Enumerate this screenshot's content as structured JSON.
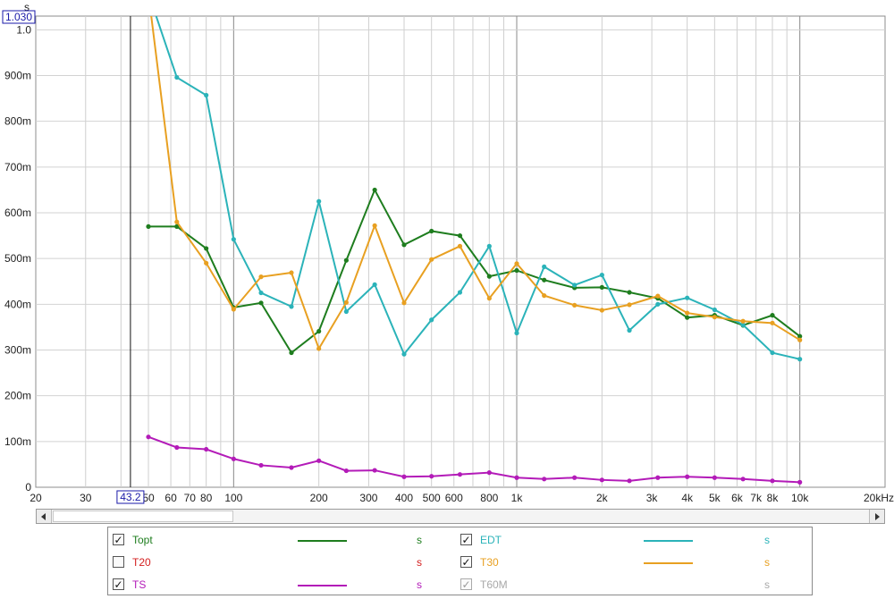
{
  "chart_data": {
    "type": "line",
    "x_scale": "log",
    "xlim": [
      20,
      20000
    ],
    "ylim": [
      0,
      1.03
    ],
    "grid": true,
    "y_unit_label": "s",
    "y_top_marker": "1.030",
    "x_cursor_label": "43.2",
    "x_cursor_value": 43.2,
    "y_ticks": [
      {
        "v": 0,
        "label": "0"
      },
      {
        "v": 0.1,
        "label": "100m"
      },
      {
        "v": 0.2,
        "label": "200m"
      },
      {
        "v": 0.3,
        "label": "300m"
      },
      {
        "v": 0.4,
        "label": "400m"
      },
      {
        "v": 0.5,
        "label": "500m"
      },
      {
        "v": 0.6,
        "label": "600m"
      },
      {
        "v": 0.7,
        "label": "700m"
      },
      {
        "v": 0.8,
        "label": "800m"
      },
      {
        "v": 0.9,
        "label": "900m"
      },
      {
        "v": 1.0,
        "label": "1.0"
      }
    ],
    "x_ticks": [
      {
        "v": 20,
        "label": "20"
      },
      {
        "v": 30,
        "label": "30"
      },
      {
        "v": 50,
        "label": "50"
      },
      {
        "v": 60,
        "label": "60"
      },
      {
        "v": 70,
        "label": "70"
      },
      {
        "v": 80,
        "label": "80"
      },
      {
        "v": 100,
        "label": "100"
      },
      {
        "v": 200,
        "label": "200"
      },
      {
        "v": 300,
        "label": "300"
      },
      {
        "v": 400,
        "label": "400"
      },
      {
        "v": 500,
        "label": "500"
      },
      {
        "v": 600,
        "label": "600"
      },
      {
        "v": 800,
        "label": "800"
      },
      {
        "v": 1000,
        "label": "1k"
      },
      {
        "v": 2000,
        "label": "2k"
      },
      {
        "v": 3000,
        "label": "3k"
      },
      {
        "v": 4000,
        "label": "4k"
      },
      {
        "v": 5000,
        "label": "5k"
      },
      {
        "v": 6000,
        "label": "6k"
      },
      {
        "v": 7000,
        "label": "7k"
      },
      {
        "v": 8000,
        "label": "8k"
      },
      {
        "v": 10000,
        "label": "10k"
      },
      {
        "v": 20000,
        "label": "20kHz"
      }
    ],
    "x": [
      50,
      63,
      80,
      100,
      125,
      160,
      200,
      250,
      315,
      400,
      500,
      630,
      800,
      1000,
      1250,
      1600,
      2000,
      2500,
      3150,
      4000,
      5000,
      6300,
      8000,
      10000
    ],
    "series": [
      {
        "name": "Topt",
        "color": "#1e7d1e",
        "values": [
          0.57,
          0.57,
          0.522,
          0.393,
          0.403,
          0.294,
          0.341,
          0.496,
          0.65,
          0.53,
          0.56,
          0.55,
          0.461,
          0.474,
          0.453,
          0.436,
          0.437,
          0.426,
          0.413,
          0.371,
          0.376,
          0.354,
          0.376,
          0.33
        ]
      },
      {
        "name": "EDT",
        "color": "#2bb3b9",
        "values": [
          1.08,
          0.896,
          0.857,
          0.542,
          0.425,
          0.395,
          0.625,
          0.384,
          0.443,
          0.291,
          0.366,
          0.426,
          0.527,
          0.337,
          0.482,
          0.442,
          0.464,
          0.343,
          0.4,
          0.414,
          0.388,
          0.355,
          0.294,
          0.28
        ]
      },
      {
        "name": "T30",
        "color": "#e8a021",
        "values": [
          1.08,
          0.58,
          0.49,
          0.389,
          0.46,
          0.469,
          0.303,
          0.404,
          0.572,
          0.403,
          0.498,
          0.527,
          0.413,
          0.489,
          0.419,
          0.398,
          0.387,
          0.399,
          0.418,
          0.381,
          0.372,
          0.363,
          0.359,
          0.322
        ]
      },
      {
        "name": "TS",
        "color": "#b31bb8",
        "values": [
          0.11,
          0.087,
          0.083,
          0.062,
          0.048,
          0.043,
          0.058,
          0.036,
          0.037,
          0.023,
          0.024,
          0.028,
          0.032,
          0.021,
          0.018,
          0.021,
          0.016,
          0.014,
          0.021,
          0.023,
          0.021,
          0.018,
          0.014,
          0.011
        ]
      }
    ]
  },
  "legend": {
    "items": [
      {
        "name": "Topt",
        "checked": true,
        "enabled": true,
        "color": "#1e7d1e",
        "unit": "s"
      },
      {
        "name": "EDT",
        "checked": true,
        "enabled": true,
        "color": "#2bb3b9",
        "unit": "s"
      },
      {
        "name": "T20",
        "checked": false,
        "enabled": true,
        "color": "#d42020",
        "unit": "s"
      },
      {
        "name": "T30",
        "checked": true,
        "enabled": true,
        "color": "#e8a021",
        "unit": "s"
      },
      {
        "name": "TS",
        "checked": true,
        "enabled": true,
        "color": "#b31bb8",
        "unit": "s"
      },
      {
        "name": "T60M",
        "checked": true,
        "enabled": false,
        "color": "#a8a8a8",
        "unit": "s"
      }
    ]
  },
  "scrollbar": {
    "left_icon": "arrow-left-icon",
    "right_icon": "arrow-right-icon"
  }
}
